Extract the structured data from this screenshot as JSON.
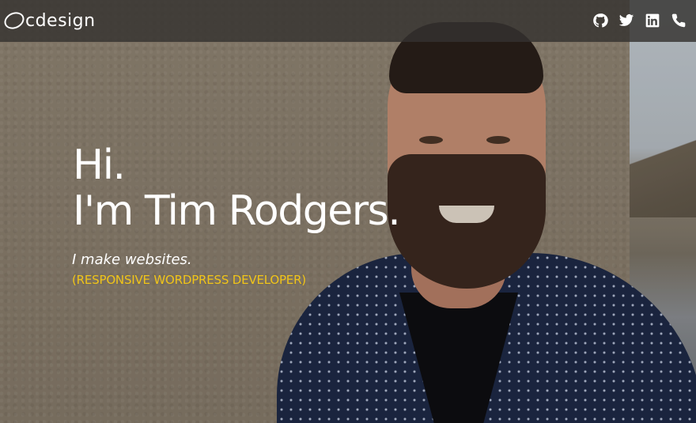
{
  "nav": {
    "logo_text": "cdesign",
    "social_icons": [
      "github-icon",
      "twitter-icon",
      "linkedin-icon",
      "phone-icon"
    ]
  },
  "hero": {
    "greeting": "Hi.",
    "name_line": "I'm Tim Rodgers.",
    "tagline": "I make websites.",
    "role": "(RESPONSIVE WORDPRESS DEVELOPER)"
  },
  "colors": {
    "accent": "#f0c419",
    "nav_bg": "#34322f",
    "text": "#ffffff"
  }
}
